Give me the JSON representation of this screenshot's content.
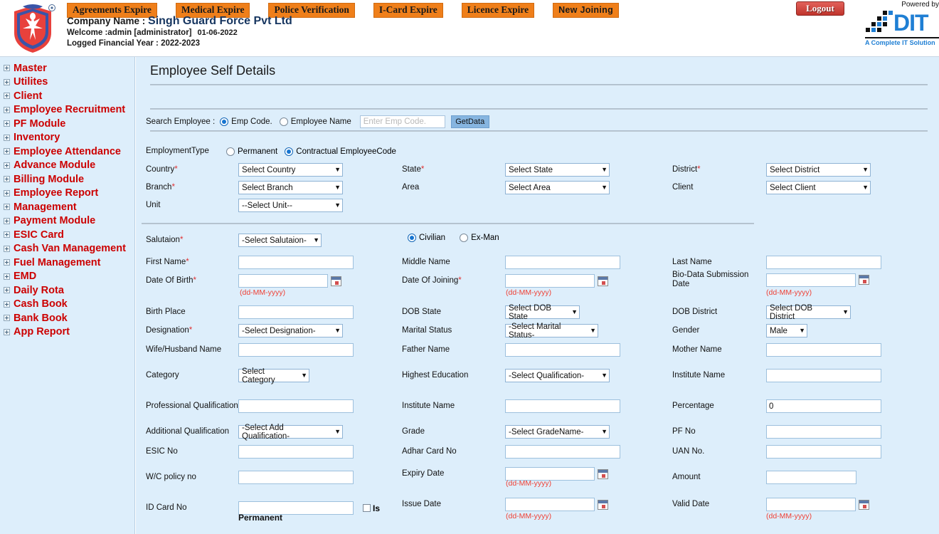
{
  "header": {
    "nav_buttons": [
      {
        "label": "Agreements Expire",
        "style": "serif"
      },
      {
        "label": "Medical Expire",
        "style": "serif"
      },
      {
        "label": "Police Verification",
        "style": "serif"
      },
      {
        "label": "I-Card Expire",
        "style": "serif"
      },
      {
        "label": "Licence Expire",
        "style": "serif"
      },
      {
        "label": "New Joining",
        "style": "sans"
      }
    ],
    "company_prefix": "Company Name : ",
    "company_name": "Singh Guard Force Pvt Ltd",
    "welcome": "Welcome :admin [administrator]",
    "welcome_date": "01-06-2022",
    "financial_year": "Logged Financial Year : 2022-2023",
    "logout_label": "Logout",
    "powered_by": "Powered by",
    "brand_text": "DIT",
    "brand_tagline": "A Complete IT Solution",
    "accent_orange": "#ef7f1a",
    "accent_blue": "#1f7fd4"
  },
  "sidebar": {
    "items": [
      {
        "label": "Master"
      },
      {
        "label": "Utilites"
      },
      {
        "label": "Client"
      },
      {
        "label": "Employee Recruitment"
      },
      {
        "label": "PF Module"
      },
      {
        "label": "Inventory"
      },
      {
        "label": "Employee Attendance"
      },
      {
        "label": "Advance Module"
      },
      {
        "label": "Billing Module"
      },
      {
        "label": "Employee Report"
      },
      {
        "label": "Management"
      },
      {
        "label": "Payment Module"
      },
      {
        "label": "ESIC Card"
      },
      {
        "label": "Cash Van Management"
      },
      {
        "label": "Fuel Management"
      },
      {
        "label": "EMD"
      },
      {
        "label": "Daily Rota"
      },
      {
        "label": "Cash Book"
      },
      {
        "label": "Bank Book"
      },
      {
        "label": "App Report"
      }
    ],
    "text_color": "#cc0000",
    "background": "#ddeefb"
  },
  "main": {
    "page_title": "Employee Self Details",
    "search": {
      "label": "Search Employee :",
      "option_emp_code": "Emp Code.",
      "option_emp_name": "Employee Name",
      "selected": "Emp Code.",
      "input_value": "",
      "input_placeholder": "Enter Emp Code.",
      "button_label": "GetData"
    },
    "employment_type": {
      "label": "EmploymentType",
      "option_permanent": "Permanent",
      "option_contractual": "Contractual EmployeeCode",
      "selected": "Contractual EmployeeCode"
    },
    "location": {
      "country_label": "Country",
      "country_value": "Select Country",
      "state_label": "State",
      "state_value": "Select State",
      "district_label": "District",
      "district_value": "Select District",
      "branch_label": "Branch",
      "branch_value": "Select Branch",
      "area_label": "Area",
      "area_value": "Select Area",
      "client_label": "Client",
      "client_value": "Select Client",
      "unit_label": "Unit",
      "unit_value": "--Select Unit--"
    },
    "personal": {
      "salutation_label": "Salutaion",
      "salutation_value": "-Select Salutaion-",
      "civilian_label": "Civilian",
      "exman_label": "Ex-Man",
      "civ_selected": "Civilian",
      "first_name_label": "First Name",
      "first_name_value": "",
      "middle_name_label": "Middle Name",
      "middle_name_value": "",
      "last_name_label": "Last Name",
      "last_name_value": "",
      "dob_label": "Date Of Birth",
      "dob_value": "",
      "doj_label": "Date Of Joining",
      "doj_value": "",
      "biodata_label": "Bio-Data Submission Date",
      "biodata_value": "",
      "date_hint": "(dd-MM-yyyy)",
      "birth_place_label": "Birth Place",
      "birth_place_value": "",
      "dob_state_label": "DOB State",
      "dob_state_value": "Select DOB State",
      "dob_district_label": "DOB District",
      "dob_district_value": "Select DOB District",
      "designation_label": "Designation",
      "designation_value": "-Select Designation-",
      "marital_label": "Marital Status",
      "marital_value": "-Select Marital Status-",
      "gender_label": "Gender",
      "gender_value": "Male",
      "spouse_label": "Wife/Husband Name",
      "spouse_value": "",
      "father_label": "Father Name",
      "father_value": "",
      "mother_label": "Mother Name",
      "mother_value": "",
      "category_label": "Category",
      "category_value": "Select Category",
      "education_label": "Highest Education",
      "education_value": "-Select Qualification-",
      "institute1_label": "Institute Name",
      "institute1_value": "",
      "prof_qual_label": "Professional Qualification",
      "prof_qual_value": "",
      "institute2_label": "Institute Name",
      "institute2_value": "",
      "percentage_label": "Percentage",
      "percentage_value": "0",
      "add_qual_label": "Additional Qualification",
      "add_qual_value": "-Select Add Qualification-",
      "grade_label": "Grade",
      "grade_value": "-Select GradeName-",
      "pf_no_label": "PF No",
      "pf_no_value": "",
      "esic_no_label": "ESIC No",
      "esic_no_value": "",
      "adhar_label": "Adhar Card No",
      "adhar_value": "",
      "uan_label": "UAN No.",
      "uan_value": "",
      "wc_policy_label": "W/C policy no",
      "wc_policy_value": "",
      "expiry_label": "Expiry Date",
      "expiry_value": "",
      "amount_label": "Amount",
      "amount_value": "",
      "id_card_label": "ID Card No",
      "id_card_value": "",
      "is_permanent_label_1": "Is",
      "is_permanent_label_2": "Permanent",
      "issue_date_label": "Issue Date",
      "issue_date_value": "",
      "valid_date_label": "Valid Date",
      "valid_date_value": ""
    }
  }
}
